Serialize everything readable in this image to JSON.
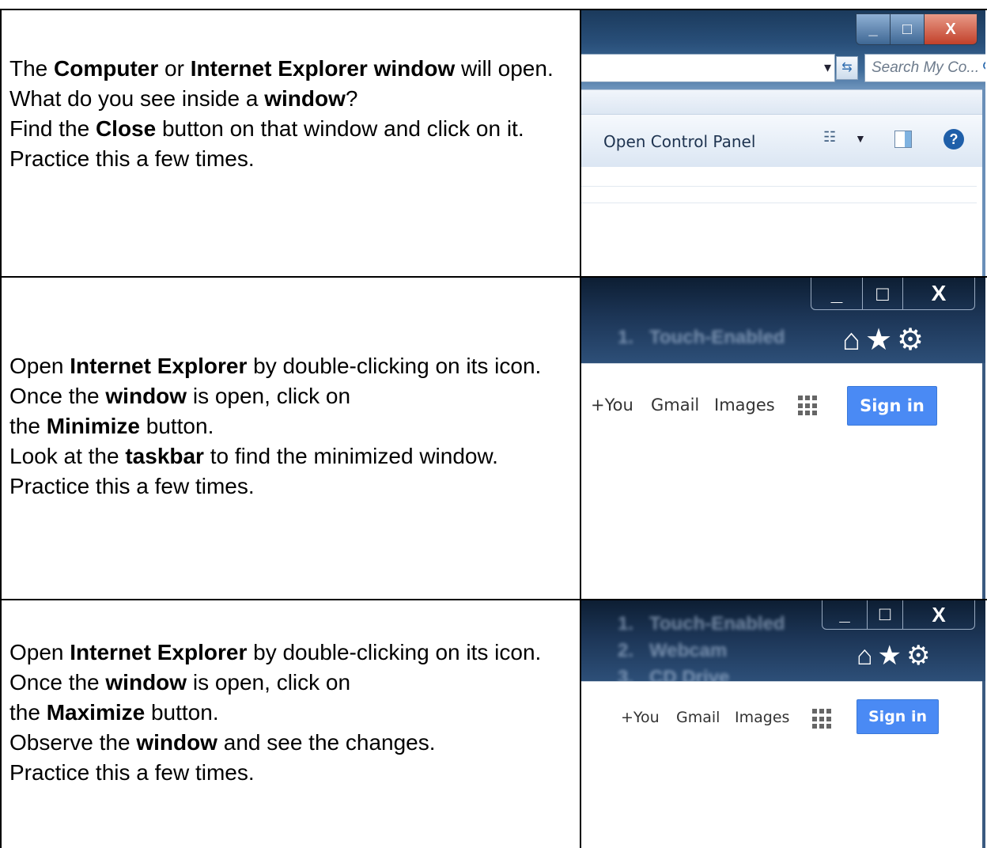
{
  "rows": [
    {
      "instruction_html": "The <b>Computer</b> or <b>Internet Explorer window</b> will open.<br>What do you see inside a <b>window</b>?<br>Find the <b>Close</b> button on that window and click on it.<br>Practice this a few times.",
      "screenshot": {
        "min_glyph": "_",
        "max_glyph": "□",
        "close_glyph": "X",
        "search_placeholder": "Search My Co...",
        "toolbar_item": "Open Control Panel",
        "help_glyph": "?"
      }
    },
    {
      "instruction_html": "Open <b>Internet Explorer</b> by double-clicking on its icon.<br>Once the <b>window</b> is open, click on<br>the <b>Minimize</b> button.<br>Look at the <b>taskbar</b> to find the minimized window.<br>Practice this a few times.",
      "screenshot": {
        "min_glyph": "_",
        "max_glyph": "□",
        "close_glyph": "X",
        "nav_icons": "⌂★⚙",
        "links": [
          "+You",
          "Gmail",
          "Images"
        ],
        "signin": "Sign in"
      }
    },
    {
      "instruction_html": "Open <b>Internet Explorer</b> by double-clicking on its icon.<br>Once the <b>window</b> is open, click on<br>the <b>Maximize</b> button.<br>Observe the <b>window</b> and see the changes.<br>Practice this a few times.",
      "screenshot": {
        "min_glyph": "_",
        "max_glyph": "□",
        "close_glyph": "X",
        "nav_icons": "⌂★⚙",
        "links": [
          "+You",
          "Gmail",
          "Images"
        ],
        "signin": "Sign in"
      }
    }
  ]
}
